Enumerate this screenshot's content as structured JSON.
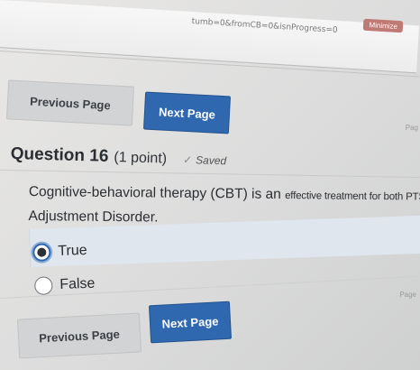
{
  "browser": {
    "url_fragment": "tumb=0&fromCB=0&isnProgress=0",
    "badge": "Minimize"
  },
  "nav": {
    "previous_label": "Previous Page",
    "next_label": "Next Page",
    "page_hint_top": "Pag",
    "page_hint_bottom": "Page"
  },
  "question": {
    "title": "Question 16",
    "points": "(1 point)",
    "saved_icon": "check-icon",
    "saved_text": "Saved",
    "statement_main": "Cognitive-behavioral therapy (CBT) is an ",
    "statement_small": "effective treatment for both PTSD",
    "statement_line2": "Adjustment Disorder.",
    "options": [
      {
        "label": "True",
        "selected": true
      },
      {
        "label": "False",
        "selected": false
      }
    ]
  },
  "colors": {
    "primary": "#2f68ae",
    "secondary_button": "#d2d3d4",
    "selected_band": "#dfe6ee"
  }
}
